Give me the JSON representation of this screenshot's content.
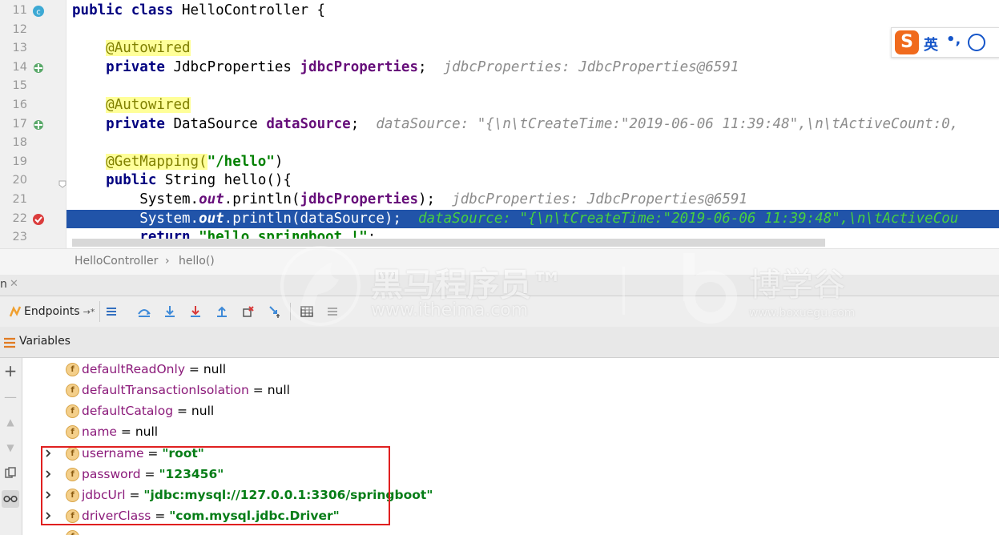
{
  "editor": {
    "lines": [
      {
        "num": "11",
        "kind": "class"
      },
      {
        "num": "12"
      },
      {
        "num": "13"
      },
      {
        "num": "14"
      },
      {
        "num": "15"
      },
      {
        "num": "16"
      },
      {
        "num": "17"
      },
      {
        "num": "18"
      },
      {
        "num": "19"
      },
      {
        "num": "20"
      },
      {
        "num": "21"
      },
      {
        "num": "22"
      },
      {
        "num": "23"
      }
    ],
    "code": {
      "l11_kw": "public class ",
      "l11_rest": "HelloController {",
      "l13_ann": "@Autowired",
      "l14_kw": "private ",
      "l14_type": "JdbcProperties ",
      "l14_field": "jdbcProperties",
      "l14_semi": ";",
      "l14_inline": "jdbcProperties: JdbcProperties@6591",
      "l16_ann": "@Autowired",
      "l17_kw": "private ",
      "l17_type": "DataSource ",
      "l17_field": "dataSource",
      "l17_semi": ";",
      "l17_inline": "dataSource: \"{\\n\\tCreateTime:\"2019-06-06 11:39:48\",\\n\\tActiveCount:0,",
      "l19_ann": "@GetMapping(",
      "l19_str": "\"/hello\"",
      "l19_close": ")",
      "l20_kw": "public ",
      "l20_rest": "String hello(){",
      "l21_a": "System.",
      "l21_out": "out",
      "l21_b": ".println(",
      "l21_field": "jdbcProperties",
      "l21_c": ");",
      "l21_inline": "jdbcProperties: JdbcProperties@6591",
      "l22_a": "System.",
      "l22_out": "out",
      "l22_b": ".println(dataSource);",
      "l22_inline": "dataSource: \"{\\n\\tCreateTime:\"2019-06-06 11:39:48\",\\n\\tActiveCou",
      "l23_kw": "return ",
      "l23_str": "\"hello springboot !\"",
      "l23_semi": ";"
    }
  },
  "breadcrumb": {
    "class": "HelloController",
    "sep": "›",
    "method": "hello()"
  },
  "tab": {
    "partial": "n",
    "close": "✕"
  },
  "toolbar": {
    "endpoints_label": "Endpoints",
    "endpoints_suffix": "→*"
  },
  "variables": {
    "title": "Variables",
    "items": [
      {
        "name": "defaultReadOnly",
        "eq": " = ",
        "value": "null",
        "is_string": false,
        "expandable": false
      },
      {
        "name": "defaultTransactionIsolation",
        "eq": " = ",
        "value": "null",
        "is_string": false,
        "expandable": false
      },
      {
        "name": "defaultCatalog",
        "eq": " = ",
        "value": "null",
        "is_string": false,
        "expandable": false
      },
      {
        "name": "name",
        "eq": " = ",
        "value": "null",
        "is_string": false,
        "expandable": false
      },
      {
        "name": "username",
        "eq": " = ",
        "value": "\"root\"",
        "is_string": true,
        "expandable": true
      },
      {
        "name": "password",
        "eq": " = ",
        "value": "\"123456\"",
        "is_string": true,
        "expandable": true
      },
      {
        "name": "jdbcUrl",
        "eq": " = ",
        "value": "\"jdbc:mysql://127.0.0.1:3306/springboot\"",
        "is_string": true,
        "expandable": true
      },
      {
        "name": "driverClass",
        "eq": " = ",
        "value": "\"com.mysql.jdbc.Driver\"",
        "is_string": true,
        "expandable": true
      }
    ],
    "field_badge": "f",
    "expand_glyph": "›"
  },
  "watermark": {
    "brand1": "黑马程序员™",
    "url1": "www.itheima.com",
    "brand2": "博学谷",
    "url2": "www.boxuegu.com"
  },
  "ime": {
    "logo": "S",
    "lang": "英",
    "punct": "•,",
    "colors": {
      "logo": "#f06a1d",
      "accent": "#1555c9"
    }
  },
  "colors": {
    "highlight_line": "#2154a9",
    "red_box": "#e02020",
    "string": "#067d17",
    "field": "#660e7a"
  }
}
